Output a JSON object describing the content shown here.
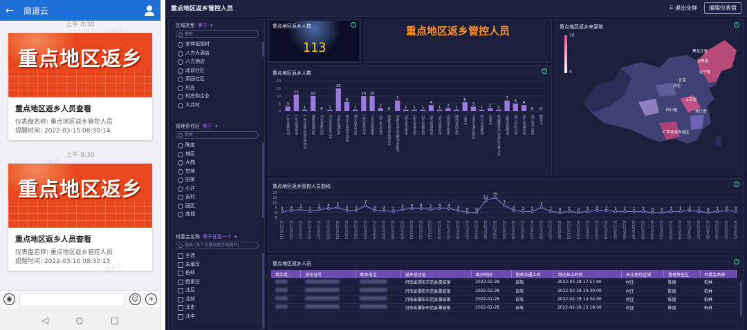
{
  "phone": {
    "app_title": "简道云",
    "messages": [
      {
        "time": "上午 8:30",
        "banner_text": "重点地区返乡",
        "card_title": "重点地区返乡人员查看",
        "dashboard_line": "仪表盘名称: 重点地区返乡管控人员",
        "remind_line": "提醒时间: 2022-03-15 08:30:14"
      },
      {
        "time": "上午 8:30",
        "banner_text": "重点地区返乡",
        "card_title": "重点地区返乡人员查看",
        "dashboard_line": "仪表盘名称: 重点地区返乡管控人员",
        "remind_line": "提醒时间: 2022-03-16 08:30:15"
      }
    ],
    "watermark": "简道云"
  },
  "dash": {
    "title": "重点地区返乡管控人员",
    "exit_fullscreen": "退出全屏",
    "edit_dashboard": "编辑仪表盘",
    "filters": [
      {
        "label": "区域类型",
        "op": "等于",
        "search": "搜索",
        "kind": "radio",
        "items": [
          "安祥福德村",
          "八方大酒店",
          "八方酒店",
          "北前社区",
          "菜园社区",
          "村庄",
          "村庄和企业",
          "大井村"
        ]
      },
      {
        "label": "管理责任区",
        "op": "等于",
        "search": "搜索",
        "kind": "radio",
        "items": [
          "陈度",
          "城区",
          "大曲",
          "甘地",
          "田家",
          "小井",
          "吉村",
          "园区",
          "苑城"
        ]
      },
      {
        "label": "村委会名称",
        "op": "等于任意一个",
        "search": "搜索 (多个关键词用空格隔开)",
        "kind": "check",
        "items": [
          "全选",
          "未填写",
          "柏林",
          "鲍家庄",
          "北后",
          "北前",
          "北史",
          "北中"
        ]
      }
    ],
    "kpi": {
      "title": "重点地区返乡人数",
      "value": "113"
    },
    "big_title": "重点地区返乡管控人员",
    "map_title": "重点地区返乡来源地",
    "map_legend": {
      "max": "16",
      "min": "0"
    },
    "map_labels": [
      "黑龙江省",
      "吉林省",
      "辽宁省",
      "北京",
      "河北",
      "江苏省",
      "浙江省",
      "四川省",
      "广西壮族自治区"
    ],
    "bar_title": "重点地区返乡人数",
    "line_title": "重点地区返乡管控人员曲线",
    "table_title": "重点地区返乡人员",
    "table": {
      "headers": [
        "真实姓...",
        "身份证号",
        "联系电话",
        "返乡前住址",
        "离开时间",
        "搭乘交通工具",
        "到达长山时间",
        "长山居住区域",
        "管理责任区",
        "村委会名称"
      ],
      "rows": [
        [
          "",
          "",
          "",
          "河南省濮阳市范县濮城镇",
          "2022-02-28",
          "自驾",
          "2022-02-28 17:57:00",
          "村庄",
          "陈度",
          "柏林"
        ],
        [
          "",
          "",
          "",
          "河南省濮阳市范县濮城镇",
          "2022-02-28",
          "自驾",
          "2022-02-28 14:30:00",
          "村庄",
          "陈度",
          "柏林"
        ],
        [
          "",
          "",
          "",
          "河南省濮阳市范县濮城镇",
          "2022-02-28",
          "自驾",
          "2022-02-28 14:34:00",
          "村庄",
          "陈度",
          "柏林"
        ],
        [
          "",
          "",
          "",
          "河南省濮阳市范县濮城镇",
          "2022-02-28",
          "自驾",
          "2022-02-28 15:18:00",
          "村庄",
          "陈度",
          "柏林"
        ]
      ]
    }
  },
  "colors": {
    "accent": "#8b5fd6",
    "bar": "#9b79e0",
    "line": "#8b8fe0",
    "header_blue": "#1f6fd9",
    "banner_red": "#e8471e",
    "kpi_gold": "#ffbe2e",
    "title_orange": "#ff9430"
  },
  "chart_data": [
    {
      "type": "bar",
      "title": "重点地区返乡人数",
      "ylim": [
        0,
        20
      ],
      "yticks": [
        0,
        5,
        10,
        15,
        20
      ],
      "categories": [
        "广东省惠州市",
        "广东省深圳市",
        "广西壮族自治区桂林市",
        "海南省海口市",
        "河北省唐山市",
        "河北省张家口市",
        "河南省濮阳市",
        "黑龙江省哈尔滨市",
        "湖北省武汉市",
        "江苏省苏州市",
        "江西省南昌市",
        "辽宁省大连市",
        "内蒙古自治区包头市",
        "内蒙古自治区鄂尔多斯市",
        "山东省济南市",
        "山东省青岛市",
        "山东省泰安市",
        "山东省潍坊市",
        "山东省烟台市",
        "山西省太原市",
        "陕西省西安市",
        "上海市",
        "上海市浦东新区",
        "四川省成都市",
        "天津市",
        "新疆维吾尔自治区乌鲁木齐市",
        "云南省昆明市",
        "浙江省杭州市",
        "浙江省温州市",
        "浙江省宁波市",
        "重庆市"
      ],
      "values": [
        3,
        11,
        1,
        10,
        0,
        1,
        15,
        6,
        1,
        10,
        10,
        2,
        0,
        7,
        1,
        1,
        1,
        4,
        1,
        2,
        1,
        6,
        3,
        1,
        2,
        1,
        7,
        5,
        4,
        0,
        0
      ]
    },
    {
      "type": "line",
      "title": "重点地区返乡管控人员曲线",
      "ylim": [
        -5,
        20
      ],
      "yticks": [
        -5,
        0,
        5,
        10,
        15,
        20
      ],
      "x": [
        "2022/01/31",
        "2022/02/20",
        "2022/02/22",
        "2022/02/25",
        "2022/02/27",
        "2022/02/28",
        "2022/02/31",
        "2022/03/01",
        "2022/03/02",
        "2022/03/03",
        "2022/03/05",
        "2022/03/06",
        "2022/03/08",
        "2022/03/09",
        "2022/03/11",
        "2022/03/12",
        "2022/03/13",
        "2022/03/14",
        "2022/03/15",
        "2022/03/16",
        "2022/03/17",
        "2022/03/19",
        "2022/03/20",
        "2022/03/23",
        "2022/03/24",
        "2022/03/25",
        "2022/03/26",
        "2022/03/27",
        "2022/03/28",
        "2022/03/29",
        "2022/03/30",
        "2022/03/31",
        "2022/04/01",
        "2022/04/02",
        "2022/04/03",
        "2022/04/04",
        "2022/04/05",
        "2022/04/06",
        "2022/04/07",
        "2022/04/08",
        "2022/04/09",
        "2022/04/11",
        "2022/04/13",
        "2022/04/14",
        "2022/04/15",
        "2022/04/17",
        "2022/04/18",
        "2022/04/19",
        "2022/04/20",
        "2022/04/21"
      ],
      "values": [
        1,
        2,
        3,
        1,
        3,
        4,
        5,
        2,
        2,
        7,
        2,
        2,
        1,
        3,
        4,
        4,
        3,
        4,
        4,
        2,
        0,
        0,
        12,
        15,
        7,
        2,
        1,
        1,
        5,
        1,
        0,
        1,
        0,
        1,
        2,
        2,
        1,
        1,
        1,
        1,
        0,
        0,
        1,
        1,
        2,
        1,
        0,
        1,
        2,
        1
      ]
    }
  ]
}
